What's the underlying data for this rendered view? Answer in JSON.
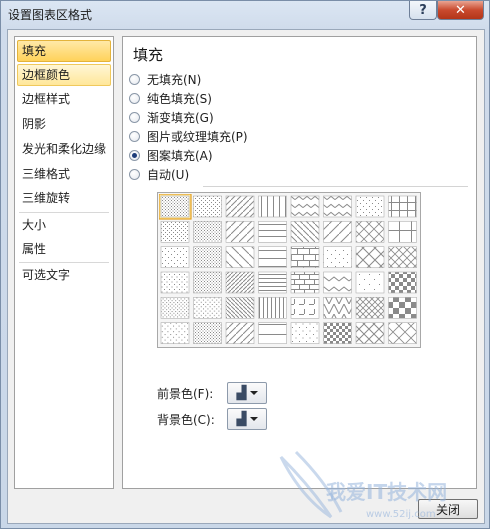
{
  "window": {
    "title": "设置图表区格式",
    "help_label": "?",
    "close_label": "✕"
  },
  "sidebar": {
    "items": [
      {
        "label": "填充"
      },
      {
        "label": "边框颜色"
      },
      {
        "label": "边框样式"
      },
      {
        "label": "阴影"
      },
      {
        "label": "发光和柔化边缘"
      },
      {
        "label": "三维格式"
      },
      {
        "label": "三维旋转"
      },
      {
        "label": "大小"
      },
      {
        "label": "属性"
      },
      {
        "label": "可选文字"
      }
    ]
  },
  "panel": {
    "title": "填充",
    "options": [
      {
        "label": "无填充(N)",
        "checked": false
      },
      {
        "label": "纯色填充(S)",
        "checked": false
      },
      {
        "label": "渐变填充(G)",
        "checked": false
      },
      {
        "label": "图片或纹理填充(P)",
        "checked": false
      },
      {
        "label": "图案填充(A)",
        "checked": true
      },
      {
        "label": "自动(U)",
        "checked": false
      }
    ],
    "foreground_label": "前景色(F):",
    "background_label": "背景色(C):",
    "pattern_grid": {
      "rows": 6,
      "cols": 8,
      "selected": "1-1"
    }
  },
  "footer": {
    "close_label": "关闭"
  },
  "watermark": {
    "text": "我爱IT技术网",
    "url": "www.52ij.com"
  },
  "colors": {
    "selected_fill": "#ffd25a",
    "accent": "#1e3d7a"
  },
  "icons": {
    "fill-color": "paint-bucket-icon",
    "dropdown": "chevron-down-icon"
  }
}
